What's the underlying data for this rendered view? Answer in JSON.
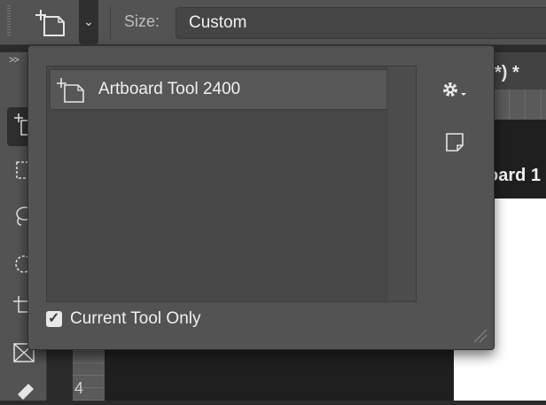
{
  "options_bar": {
    "size_label": "Size:",
    "size_value": "Custom",
    "preset_dropdown_icon": "chevron-down-icon"
  },
  "document": {
    "tab_title_fragment": "*) *",
    "artboard_label_fragment": "oard 1",
    "ruler_number": "4"
  },
  "preset_picker": {
    "presets": [
      {
        "label": "Artboard Tool 2400",
        "icon": "artboard-tool-icon"
      }
    ],
    "gear_icon": "gear-icon",
    "new_preset_icon": "new-preset-icon",
    "current_tool_only": {
      "label": "Current Tool Only",
      "checked": true
    }
  },
  "toolbar": {
    "collapse_label": ">>",
    "tools": [
      "artboard-tool-icon",
      "marquee-tool-icon",
      "lasso-tool-icon",
      "quick-selection-tool-icon",
      "crop-tool-icon",
      "frame-tool-icon",
      "eyedropper-tool-icon"
    ]
  },
  "colors": {
    "panel": "#535353",
    "panel_dark": "#2f2f2f",
    "list_bg": "#474747",
    "canvas": "#1f1f1f",
    "artboard": "#ffffff"
  }
}
